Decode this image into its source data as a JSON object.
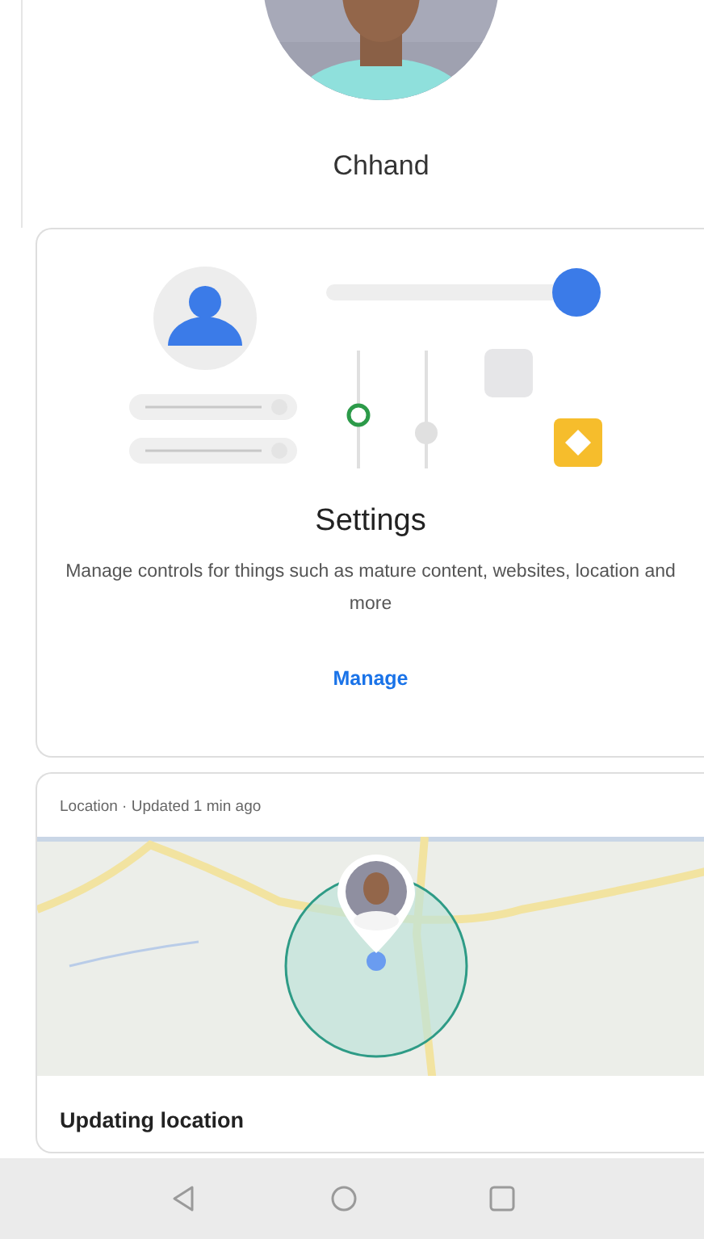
{
  "profile": {
    "name": "Chhand"
  },
  "settings_card": {
    "title": "Settings",
    "description": "Manage controls for things such as mature content, websites, location and more",
    "link": "Manage"
  },
  "location_card": {
    "header": "Location · Updated 1 min ago",
    "status": "Updating location"
  },
  "nav_bar": {
    "buttons": [
      {
        "kind": "back"
      },
      {
        "kind": "home"
      },
      {
        "kind": "recents"
      }
    ]
  }
}
